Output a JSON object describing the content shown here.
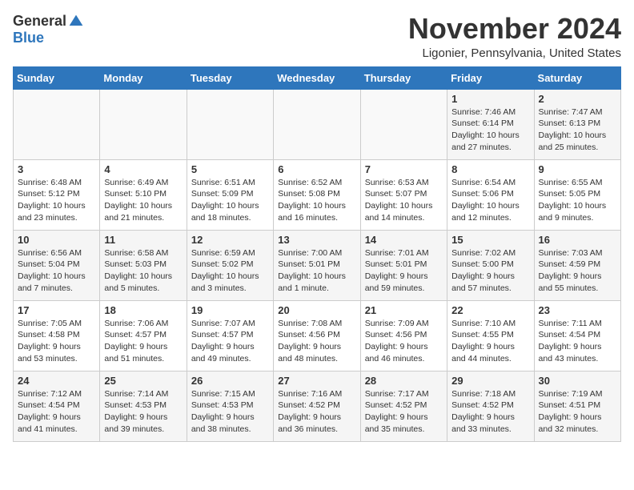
{
  "header": {
    "logo_general": "General",
    "logo_blue": "Blue",
    "month_title": "November 2024",
    "location": "Ligonier, Pennsylvania, United States"
  },
  "weekdays": [
    "Sunday",
    "Monday",
    "Tuesday",
    "Wednesday",
    "Thursday",
    "Friday",
    "Saturday"
  ],
  "weeks": [
    [
      {
        "day": "",
        "info": ""
      },
      {
        "day": "",
        "info": ""
      },
      {
        "day": "",
        "info": ""
      },
      {
        "day": "",
        "info": ""
      },
      {
        "day": "",
        "info": ""
      },
      {
        "day": "1",
        "info": "Sunrise: 7:46 AM\nSunset: 6:14 PM\nDaylight: 10 hours and 27 minutes."
      },
      {
        "day": "2",
        "info": "Sunrise: 7:47 AM\nSunset: 6:13 PM\nDaylight: 10 hours and 25 minutes."
      }
    ],
    [
      {
        "day": "3",
        "info": "Sunrise: 6:48 AM\nSunset: 5:12 PM\nDaylight: 10 hours and 23 minutes."
      },
      {
        "day": "4",
        "info": "Sunrise: 6:49 AM\nSunset: 5:10 PM\nDaylight: 10 hours and 21 minutes."
      },
      {
        "day": "5",
        "info": "Sunrise: 6:51 AM\nSunset: 5:09 PM\nDaylight: 10 hours and 18 minutes."
      },
      {
        "day": "6",
        "info": "Sunrise: 6:52 AM\nSunset: 5:08 PM\nDaylight: 10 hours and 16 minutes."
      },
      {
        "day": "7",
        "info": "Sunrise: 6:53 AM\nSunset: 5:07 PM\nDaylight: 10 hours and 14 minutes."
      },
      {
        "day": "8",
        "info": "Sunrise: 6:54 AM\nSunset: 5:06 PM\nDaylight: 10 hours and 12 minutes."
      },
      {
        "day": "9",
        "info": "Sunrise: 6:55 AM\nSunset: 5:05 PM\nDaylight: 10 hours and 9 minutes."
      }
    ],
    [
      {
        "day": "10",
        "info": "Sunrise: 6:56 AM\nSunset: 5:04 PM\nDaylight: 10 hours and 7 minutes."
      },
      {
        "day": "11",
        "info": "Sunrise: 6:58 AM\nSunset: 5:03 PM\nDaylight: 10 hours and 5 minutes."
      },
      {
        "day": "12",
        "info": "Sunrise: 6:59 AM\nSunset: 5:02 PM\nDaylight: 10 hours and 3 minutes."
      },
      {
        "day": "13",
        "info": "Sunrise: 7:00 AM\nSunset: 5:01 PM\nDaylight: 10 hours and 1 minute."
      },
      {
        "day": "14",
        "info": "Sunrise: 7:01 AM\nSunset: 5:01 PM\nDaylight: 9 hours and 59 minutes."
      },
      {
        "day": "15",
        "info": "Sunrise: 7:02 AM\nSunset: 5:00 PM\nDaylight: 9 hours and 57 minutes."
      },
      {
        "day": "16",
        "info": "Sunrise: 7:03 AM\nSunset: 4:59 PM\nDaylight: 9 hours and 55 minutes."
      }
    ],
    [
      {
        "day": "17",
        "info": "Sunrise: 7:05 AM\nSunset: 4:58 PM\nDaylight: 9 hours and 53 minutes."
      },
      {
        "day": "18",
        "info": "Sunrise: 7:06 AM\nSunset: 4:57 PM\nDaylight: 9 hours and 51 minutes."
      },
      {
        "day": "19",
        "info": "Sunrise: 7:07 AM\nSunset: 4:57 PM\nDaylight: 9 hours and 49 minutes."
      },
      {
        "day": "20",
        "info": "Sunrise: 7:08 AM\nSunset: 4:56 PM\nDaylight: 9 hours and 48 minutes."
      },
      {
        "day": "21",
        "info": "Sunrise: 7:09 AM\nSunset: 4:56 PM\nDaylight: 9 hours and 46 minutes."
      },
      {
        "day": "22",
        "info": "Sunrise: 7:10 AM\nSunset: 4:55 PM\nDaylight: 9 hours and 44 minutes."
      },
      {
        "day": "23",
        "info": "Sunrise: 7:11 AM\nSunset: 4:54 PM\nDaylight: 9 hours and 43 minutes."
      }
    ],
    [
      {
        "day": "24",
        "info": "Sunrise: 7:12 AM\nSunset: 4:54 PM\nDaylight: 9 hours and 41 minutes."
      },
      {
        "day": "25",
        "info": "Sunrise: 7:14 AM\nSunset: 4:53 PM\nDaylight: 9 hours and 39 minutes."
      },
      {
        "day": "26",
        "info": "Sunrise: 7:15 AM\nSunset: 4:53 PM\nDaylight: 9 hours and 38 minutes."
      },
      {
        "day": "27",
        "info": "Sunrise: 7:16 AM\nSunset: 4:52 PM\nDaylight: 9 hours and 36 minutes."
      },
      {
        "day": "28",
        "info": "Sunrise: 7:17 AM\nSunset: 4:52 PM\nDaylight: 9 hours and 35 minutes."
      },
      {
        "day": "29",
        "info": "Sunrise: 7:18 AM\nSunset: 4:52 PM\nDaylight: 9 hours and 33 minutes."
      },
      {
        "day": "30",
        "info": "Sunrise: 7:19 AM\nSunset: 4:51 PM\nDaylight: 9 hours and 32 minutes."
      }
    ]
  ]
}
